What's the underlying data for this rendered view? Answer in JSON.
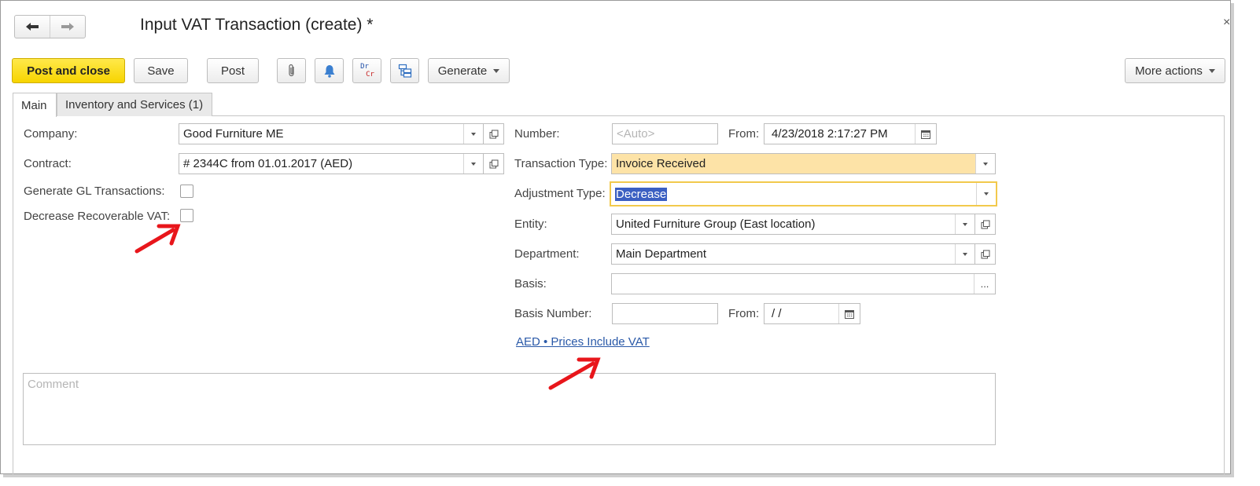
{
  "window": {
    "title": "Input VAT Transaction (create) *",
    "close_glyph": "×"
  },
  "toolbar": {
    "post_and_close": "Post and close",
    "save": "Save",
    "post": "Post",
    "dr_label": "Dr",
    "cr_label": "Cr",
    "generate": "Generate",
    "more_actions": "More actions"
  },
  "tabs": [
    {
      "label": "Main"
    },
    {
      "label": "Inventory and Services (1)"
    }
  ],
  "form": {
    "company": {
      "label": "Company:",
      "value": "Good Furniture ME"
    },
    "contract": {
      "label": "Contract:",
      "value": "# 2344C from 01.01.2017 (AED)"
    },
    "generate_gl": {
      "label": "Generate GL Transactions:"
    },
    "decrease_vat": {
      "label": "Decrease Recoverable VAT:"
    },
    "number": {
      "label": "Number:",
      "placeholder": "<Auto>"
    },
    "from": {
      "label": "From:",
      "value": "4/23/2018  2:17:27 PM"
    },
    "transaction_type": {
      "label": "Transaction Type:",
      "value": "Invoice Received"
    },
    "adjustment_type": {
      "label": "Adjustment Type:",
      "value": "Decrease"
    },
    "entity": {
      "label": "Entity:",
      "value": "United Furniture Group (East location)"
    },
    "department": {
      "label": "Department:",
      "value": "Main Department"
    },
    "basis": {
      "label": "Basis:",
      "value": "",
      "button": "..."
    },
    "basis_number": {
      "label": "Basis Number:",
      "value": ""
    },
    "basis_from": {
      "label": "From:",
      "value": " /  /"
    },
    "currency_link": "AED • Prices Include VAT",
    "comment_placeholder": "Comment"
  },
  "colors": {
    "primary_button": "#f7d400",
    "transaction_type_bg": "#fde3a7",
    "focus_border": "#f2c94c",
    "link": "#2a59a8",
    "annotation_arrow": "#e8161b"
  }
}
